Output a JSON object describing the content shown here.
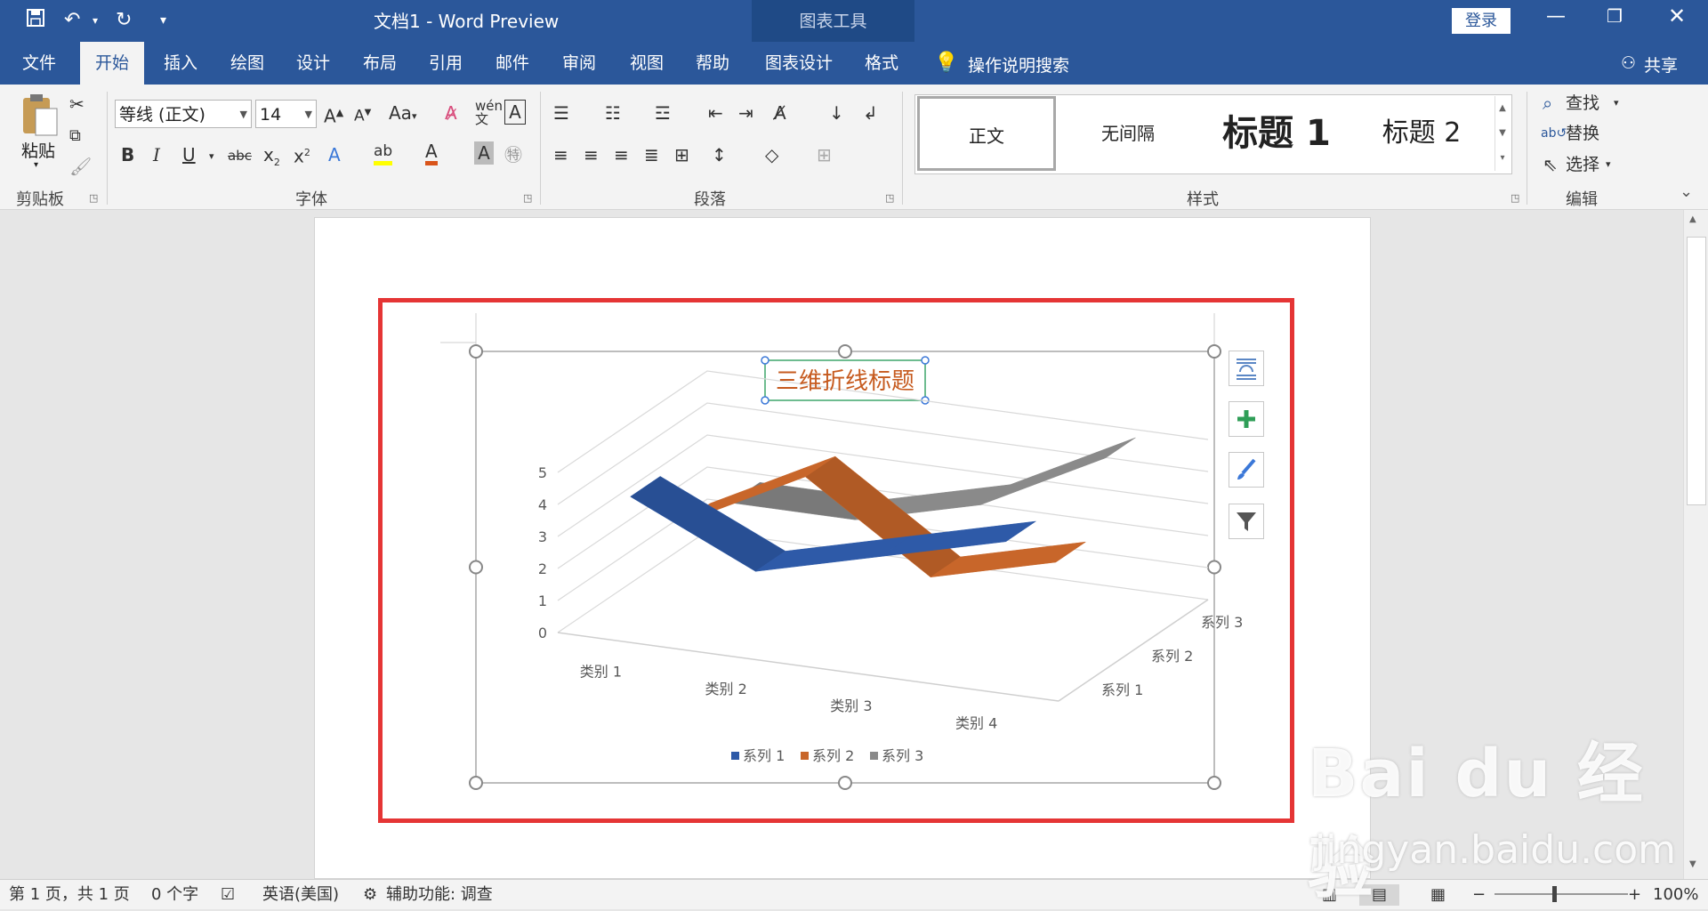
{
  "window": {
    "title": "文档1 - Word Preview",
    "contextual_tab": "图表工具",
    "login_label": "登录",
    "share_label": "共享"
  },
  "tabs": [
    "文件",
    "开始",
    "插入",
    "绘图",
    "设计",
    "布局",
    "引用",
    "邮件",
    "审阅",
    "视图",
    "帮助",
    "图表设计",
    "格式"
  ],
  "search_label": "操作说明搜索",
  "ribbon": {
    "clipboard": {
      "paste_label": "粘贴",
      "group_label": "剪贴板"
    },
    "font": {
      "font_name": "等线 (正文)",
      "font_size": "14",
      "group_label": "字体"
    },
    "paragraph": {
      "group_label": "段落"
    },
    "styles": {
      "items": [
        "正文",
        "无间隔",
        "标题 1",
        "标题 2"
      ],
      "group_label": "样式"
    },
    "editing": {
      "find_label": "查找",
      "replace_label": "替换",
      "select_label": "选择",
      "group_label": "编辑"
    }
  },
  "chart_data": {
    "type": "line",
    "title": "三维折线标题",
    "categories": [
      "类别 1",
      "类别 2",
      "类别 3",
      "类别 4"
    ],
    "series": [
      {
        "name": "系列 1",
        "values": [
          4.3,
          2.5,
          3.5,
          4.5
        ],
        "color": "#2e5aa8"
      },
      {
        "name": "系列 2",
        "values": [
          2.4,
          4.4,
          1.8,
          2.8
        ],
        "color": "#c8662a"
      },
      {
        "name": "系列 3",
        "values": [
          2,
          2,
          3,
          5
        ],
        "color": "#8a8a8a"
      }
    ],
    "yticks": [
      "0",
      "1",
      "2",
      "3",
      "4",
      "5"
    ],
    "ylim": [
      0,
      5
    ],
    "depth_labels": [
      "系列 1",
      "系列 2",
      "系列 3"
    ],
    "legend_position": "bottom",
    "grid": true
  },
  "status": {
    "page": "第 1 页，共 1 页",
    "words": "0 个字",
    "language": "英语(美国)",
    "accessibility": "辅助功能: 调查",
    "zoom": "100%"
  },
  "watermark": {
    "brand": "Bai du 经验",
    "url": "jingyan.baidu.com"
  }
}
